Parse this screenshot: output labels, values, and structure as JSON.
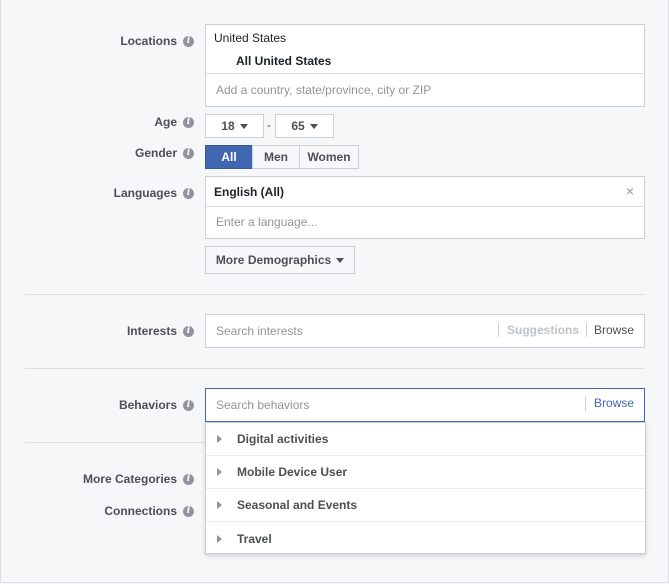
{
  "locations": {
    "label": "Locations",
    "country": "United States",
    "selected": "All United States",
    "placeholder": "Add a country, state/province, city or ZIP"
  },
  "age": {
    "label": "Age",
    "min": "18",
    "sep": "-",
    "max": "65"
  },
  "gender": {
    "label": "Gender",
    "options": [
      "All",
      "Men",
      "Women"
    ],
    "active": "All"
  },
  "languages": {
    "label": "Languages",
    "selected": "English (All)",
    "remove": "×",
    "placeholder": "Enter a language..."
  },
  "more_demographics": {
    "label": "More Demographics"
  },
  "interests": {
    "label": "Interests",
    "placeholder": "Search interests",
    "suggestions": "Suggestions",
    "browse": "Browse"
  },
  "behaviors": {
    "label": "Behaviors",
    "placeholder": "Search behaviors",
    "browse": "Browse",
    "items": [
      "Digital activities",
      "Mobile Device User",
      "Seasonal and Events",
      "Travel"
    ]
  },
  "more_categories": {
    "label": "More Categories"
  },
  "connections": {
    "label": "Connections"
  },
  "colors": {
    "accent": "#4267b2",
    "link": "#4267b2",
    "border": "#ccd0d5"
  }
}
